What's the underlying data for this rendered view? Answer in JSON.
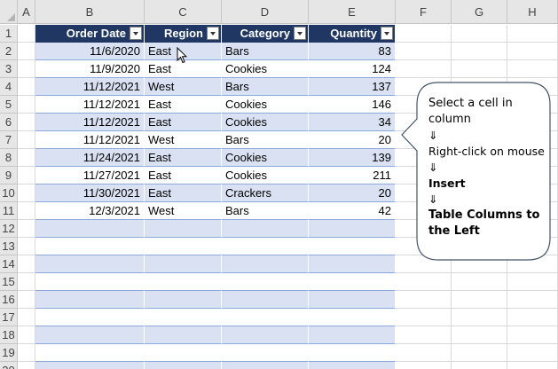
{
  "columns": [
    "A",
    "B",
    "C",
    "D",
    "E",
    "F",
    "G",
    "H"
  ],
  "rows": [
    "1",
    "2",
    "3",
    "4",
    "5",
    "6",
    "7",
    "8",
    "9",
    "10",
    "11",
    "12",
    "13",
    "14",
    "15",
    "16",
    "17",
    "18",
    "19",
    "20"
  ],
  "table": {
    "headers": [
      "Order Date",
      "Region",
      "Category",
      "Quantity"
    ],
    "rows": [
      {
        "date": "11/6/2020",
        "region": "East",
        "category": "Bars",
        "quantity": "83"
      },
      {
        "date": "11/9/2020",
        "region": "East",
        "category": "Cookies",
        "quantity": "124"
      },
      {
        "date": "11/12/2021",
        "region": "West",
        "category": "Bars",
        "quantity": "137"
      },
      {
        "date": "11/12/2021",
        "region": "East",
        "category": "Cookies",
        "quantity": "146"
      },
      {
        "date": "11/12/2021",
        "region": "East",
        "category": "Cookies",
        "quantity": "34"
      },
      {
        "date": "11/12/2021",
        "region": "West",
        "category": "Bars",
        "quantity": "20"
      },
      {
        "date": "11/24/2021",
        "region": "East",
        "category": "Cookies",
        "quantity": "139"
      },
      {
        "date": "11/27/2021",
        "region": "East",
        "category": "Cookies",
        "quantity": "211"
      },
      {
        "date": "11/30/2021",
        "region": "East",
        "category": "Crackers",
        "quantity": "20"
      },
      {
        "date": "12/3/2021",
        "region": "West",
        "category": "Bars",
        "quantity": "42"
      }
    ],
    "header_color": "#203764",
    "band_color": "#d9e1f2"
  },
  "callout": {
    "line1": "Select a cell in",
    "line2": "column",
    "arrow1": "⇓",
    "line3": "Right-click on mouse",
    "arrow2": "⇓",
    "line4": "Insert",
    "arrow3": "⇓",
    "line5": "Table Columns to",
    "line6": "the Left"
  },
  "cursor_icon": "mouse-pointer-icon"
}
